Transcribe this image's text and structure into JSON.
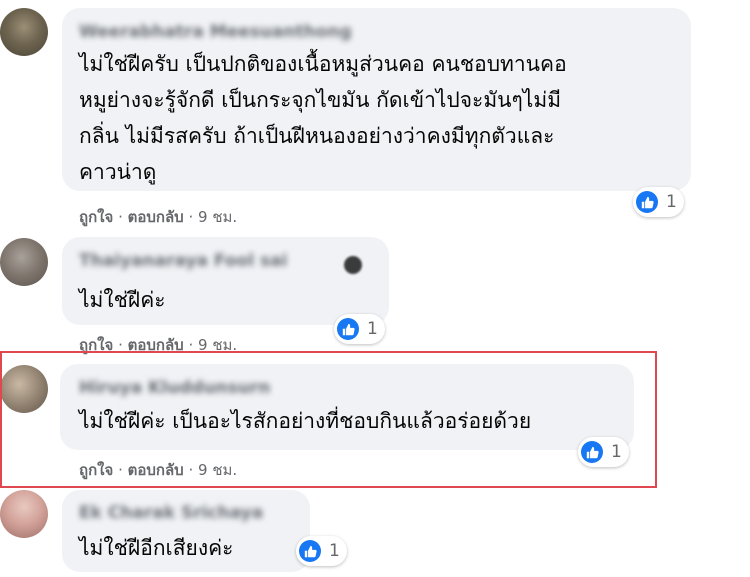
{
  "comments": [
    {
      "author": "Weerabhatra Meesuanthong",
      "text_lines": [
        "ไม่ใช่ฝีครับ เป็นปกติของเนื้อหมูส่วนคอ คนชอบทานคอ",
        "หมูย่างจะรู้จักดี เป็นกระจุกไขมัน กัดเข้าไปจะมันๆไม่มี",
        "กลิ่น ไม่มีรสครับ ถ้าเป็นฝีหนองอย่างว่าคงมีทุกตัวและ",
        "คาวน่าดู"
      ],
      "like_label": "ถูกใจ",
      "reply_label": "ตอบกลับ",
      "time": "9 ชม.",
      "reaction_count": "1"
    },
    {
      "author": "Thaiyanaraya Fool sai",
      "text_lines": [
        "ไม่ใช่ฝีค่ะ"
      ],
      "like_label": "ถูกใจ",
      "reply_label": "ตอบกลับ",
      "time": "9 ชม.",
      "reaction_count": "1"
    },
    {
      "author": "Hiruya Kluddunsurn",
      "text_lines": [
        "ไม่ใช่ฝีค่ะ เป็นอะไรสักอย่างที่ชอบกินแล้วอร่อยด้วย"
      ],
      "like_label": "ถูกใจ",
      "reply_label": "ตอบกลับ",
      "time": "9 ชม.",
      "reaction_count": "1"
    },
    {
      "author": "Ek Charak Srichaya",
      "text_lines": [
        "ไม่ใช่ฝีอีกเสียงค่ะ"
      ],
      "reaction_count": "1"
    }
  ],
  "separator": "·",
  "colors": {
    "bubble": "#f0f2f5",
    "like_blue": "#1877f2",
    "highlight_red": "#e0484f",
    "meta_gray": "#65676b"
  },
  "icons": [
    "like-icon"
  ]
}
